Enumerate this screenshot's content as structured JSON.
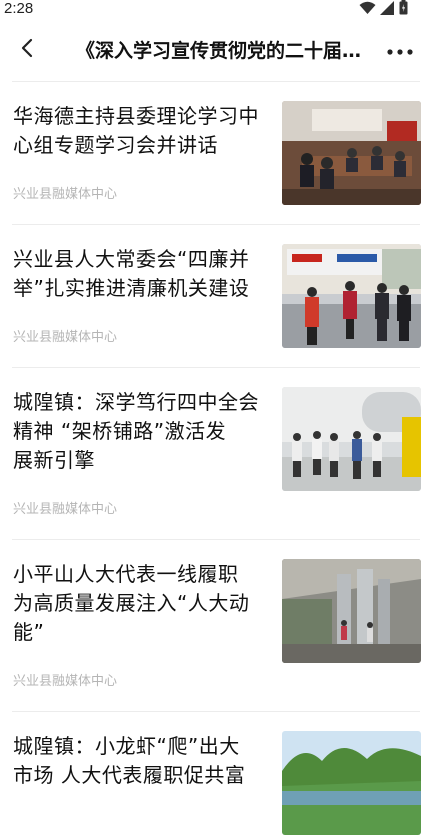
{
  "status_bar": {
    "time": "2:28",
    "icons": [
      "wifi-icon",
      "signal-icon",
      "battery-icon"
    ]
  },
  "nav": {
    "back_icon": "chevron-left-icon",
    "title": "《深入学习宣传贯彻党的二十届四中全会精神》",
    "more_icon": "more-horizontal-icon"
  },
  "articles": [
    {
      "title_lines": [
        "华海德主持县委理论学习中",
        "心组专题学习会并讲话"
      ],
      "source": "兴业县融媒体中心",
      "thumbnail": "meeting-room-photo"
    },
    {
      "title_lines": [
        "兴业县人大常委会“四廉并",
        "举”扎实推进清廉机关建设"
      ],
      "source": "兴业县融媒体中心",
      "thumbnail": "site-visit-photo"
    },
    {
      "title_lines": [
        "城隍镇：深学笃行四中全会",
        "精神 “架桥铺路”激活发",
        "展新引擎"
      ],
      "source": "兴业县融媒体中心",
      "thumbnail": "factory-inspection-photo"
    },
    {
      "title_lines": [
        "小平山人大代表一线履职",
        "为高质量发展注入“人大动",
        "能”"
      ],
      "source": "兴业县融媒体中心",
      "thumbnail": "workshop-photo"
    },
    {
      "title_lines": [
        "城隍镇：小龙虾“爬”出大",
        "市场 人大代表履职促共富"
      ],
      "source": "",
      "thumbnail": "landscape-photo"
    }
  ],
  "colors": {
    "text": "#111111",
    "source": "#b5b5b5",
    "divider": "#ececec"
  }
}
